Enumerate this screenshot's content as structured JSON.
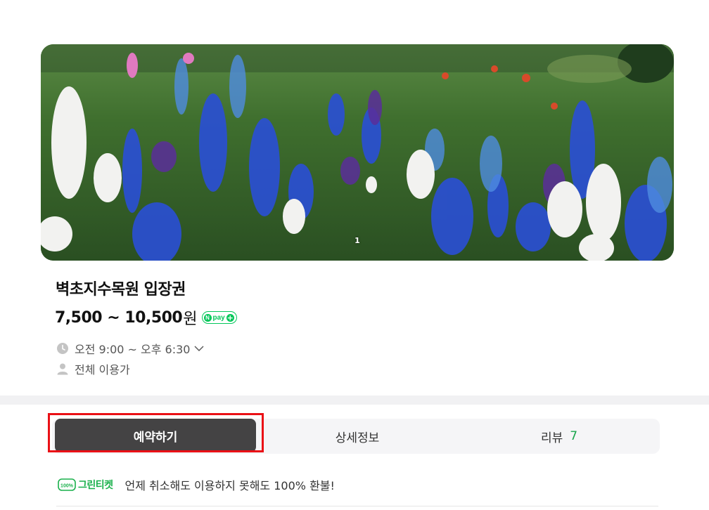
{
  "hero": {
    "page_indicator": "1"
  },
  "product": {
    "title": "벽초지수목원 입장권",
    "price": "7,500 ~ 10,500",
    "price_unit": "원",
    "pay_badge": "pay"
  },
  "info": {
    "hours": "오전 9:00 ~ 오후 6:30",
    "audience": "전체 이용가"
  },
  "tabs": [
    {
      "label": "예약하기"
    },
    {
      "label": "상세정보"
    },
    {
      "label": "리뷰",
      "count": "7"
    }
  ],
  "notice": {
    "badge_label": "그린티켓",
    "badge_percent": "100%",
    "text": "언제 취소해도 이용하지 못해도 100% 환불!"
  },
  "colors": {
    "accent_green": "#03c75a",
    "active_tab_bg": "#444344",
    "highlight_red": "#ea1016",
    "review_count_green": "#18a54b"
  }
}
